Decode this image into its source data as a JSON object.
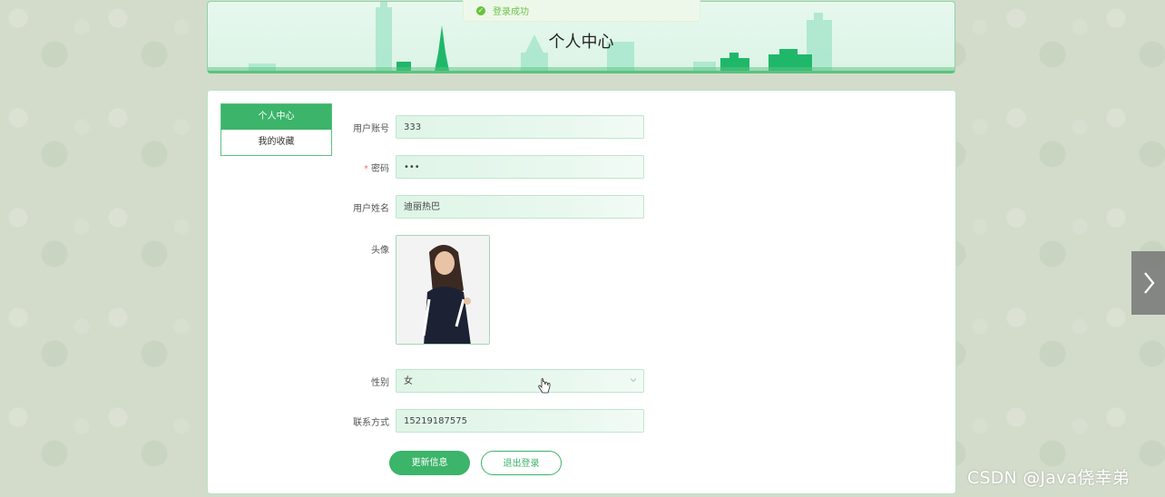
{
  "toast": {
    "message": "登录成功",
    "icon": "check-circle-icon"
  },
  "banner": {
    "title": "个人中心"
  },
  "sidenav": {
    "items": [
      {
        "label": "个人中心",
        "active": true
      },
      {
        "label": "我的收藏",
        "active": false
      }
    ]
  },
  "form": {
    "account_label": "用户账号",
    "account_value": "333",
    "password_required_mark": "*",
    "password_label": "密码",
    "password_value": "•••",
    "name_label": "用户姓名",
    "name_value": "迪丽热巴",
    "avatar_label": "头像",
    "gender_label": "性别",
    "gender_value": "女",
    "phone_label": "联系方式",
    "phone_value": "15219187575"
  },
  "buttons": {
    "update": "更新信息",
    "logout": "退出登录"
  },
  "watermark": "CSDN @Java侥幸弟",
  "colors": {
    "accent": "#3cb46a",
    "success": "#67c23a"
  }
}
